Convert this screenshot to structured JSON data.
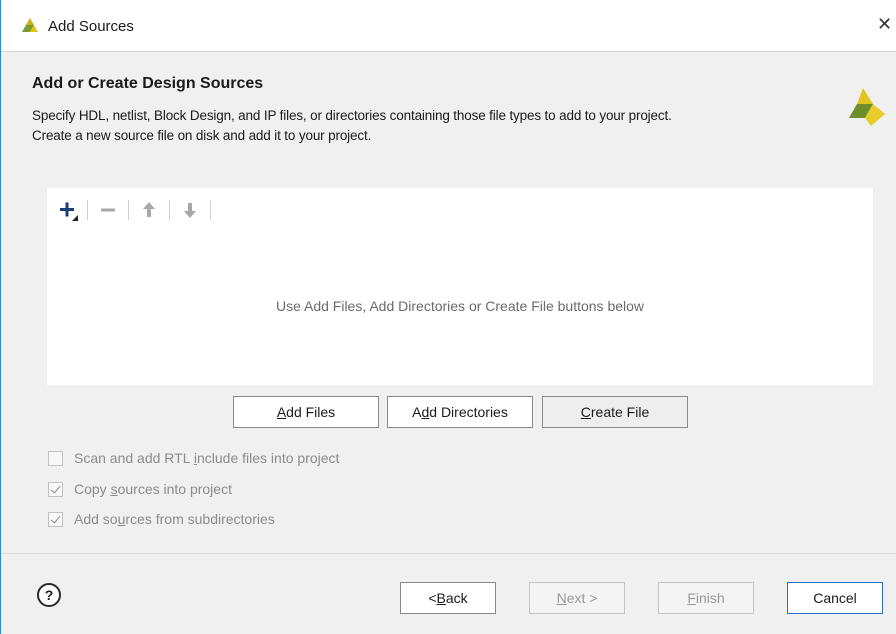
{
  "window": {
    "title": "Add Sources",
    "close_glyph": "✕"
  },
  "header": {
    "heading": "Add or Create Design Sources",
    "description_line1": "Specify HDL, netlist, Block Design, and IP files, or directories containing those file types to add to your project.",
    "description_line2": "Create a new source file on disk and add it to your project."
  },
  "toolbar": {
    "icons": [
      "add-icon",
      "remove-icon",
      "move-up-icon",
      "move-down-icon"
    ]
  },
  "file_list": {
    "empty_message": "Use Add Files, Add Directories or Create File buttons below"
  },
  "actions": {
    "add_files": {
      "pre": "",
      "key": "A",
      "post": "dd Files"
    },
    "add_directories": {
      "pre": "A",
      "key": "d",
      "post": "d Directories"
    },
    "create_file": {
      "pre": "",
      "key": "C",
      "post": "reate File"
    }
  },
  "options": [
    {
      "pre": "Scan and add RTL ",
      "key": "i",
      "post": "nclude files into project",
      "checked": false
    },
    {
      "pre": "Copy ",
      "key": "s",
      "post": "ources into project",
      "checked": true
    },
    {
      "pre": "Add so",
      "key": "u",
      "post": "rces from subdirectories",
      "checked": true
    }
  ],
  "footer": {
    "help_glyph": "?",
    "back": {
      "pre": "< ",
      "key": "B",
      "post": "ack"
    },
    "next": {
      "pre": "",
      "key": "N",
      "post": "ext >"
    },
    "finish": {
      "pre": "",
      "key": "F",
      "post": "inish"
    },
    "cancel": "Cancel"
  },
  "colors": {
    "accent_border": "#2b88d8",
    "logo_green": "#6d8e2a",
    "logo_yellow": "#e2c620"
  }
}
